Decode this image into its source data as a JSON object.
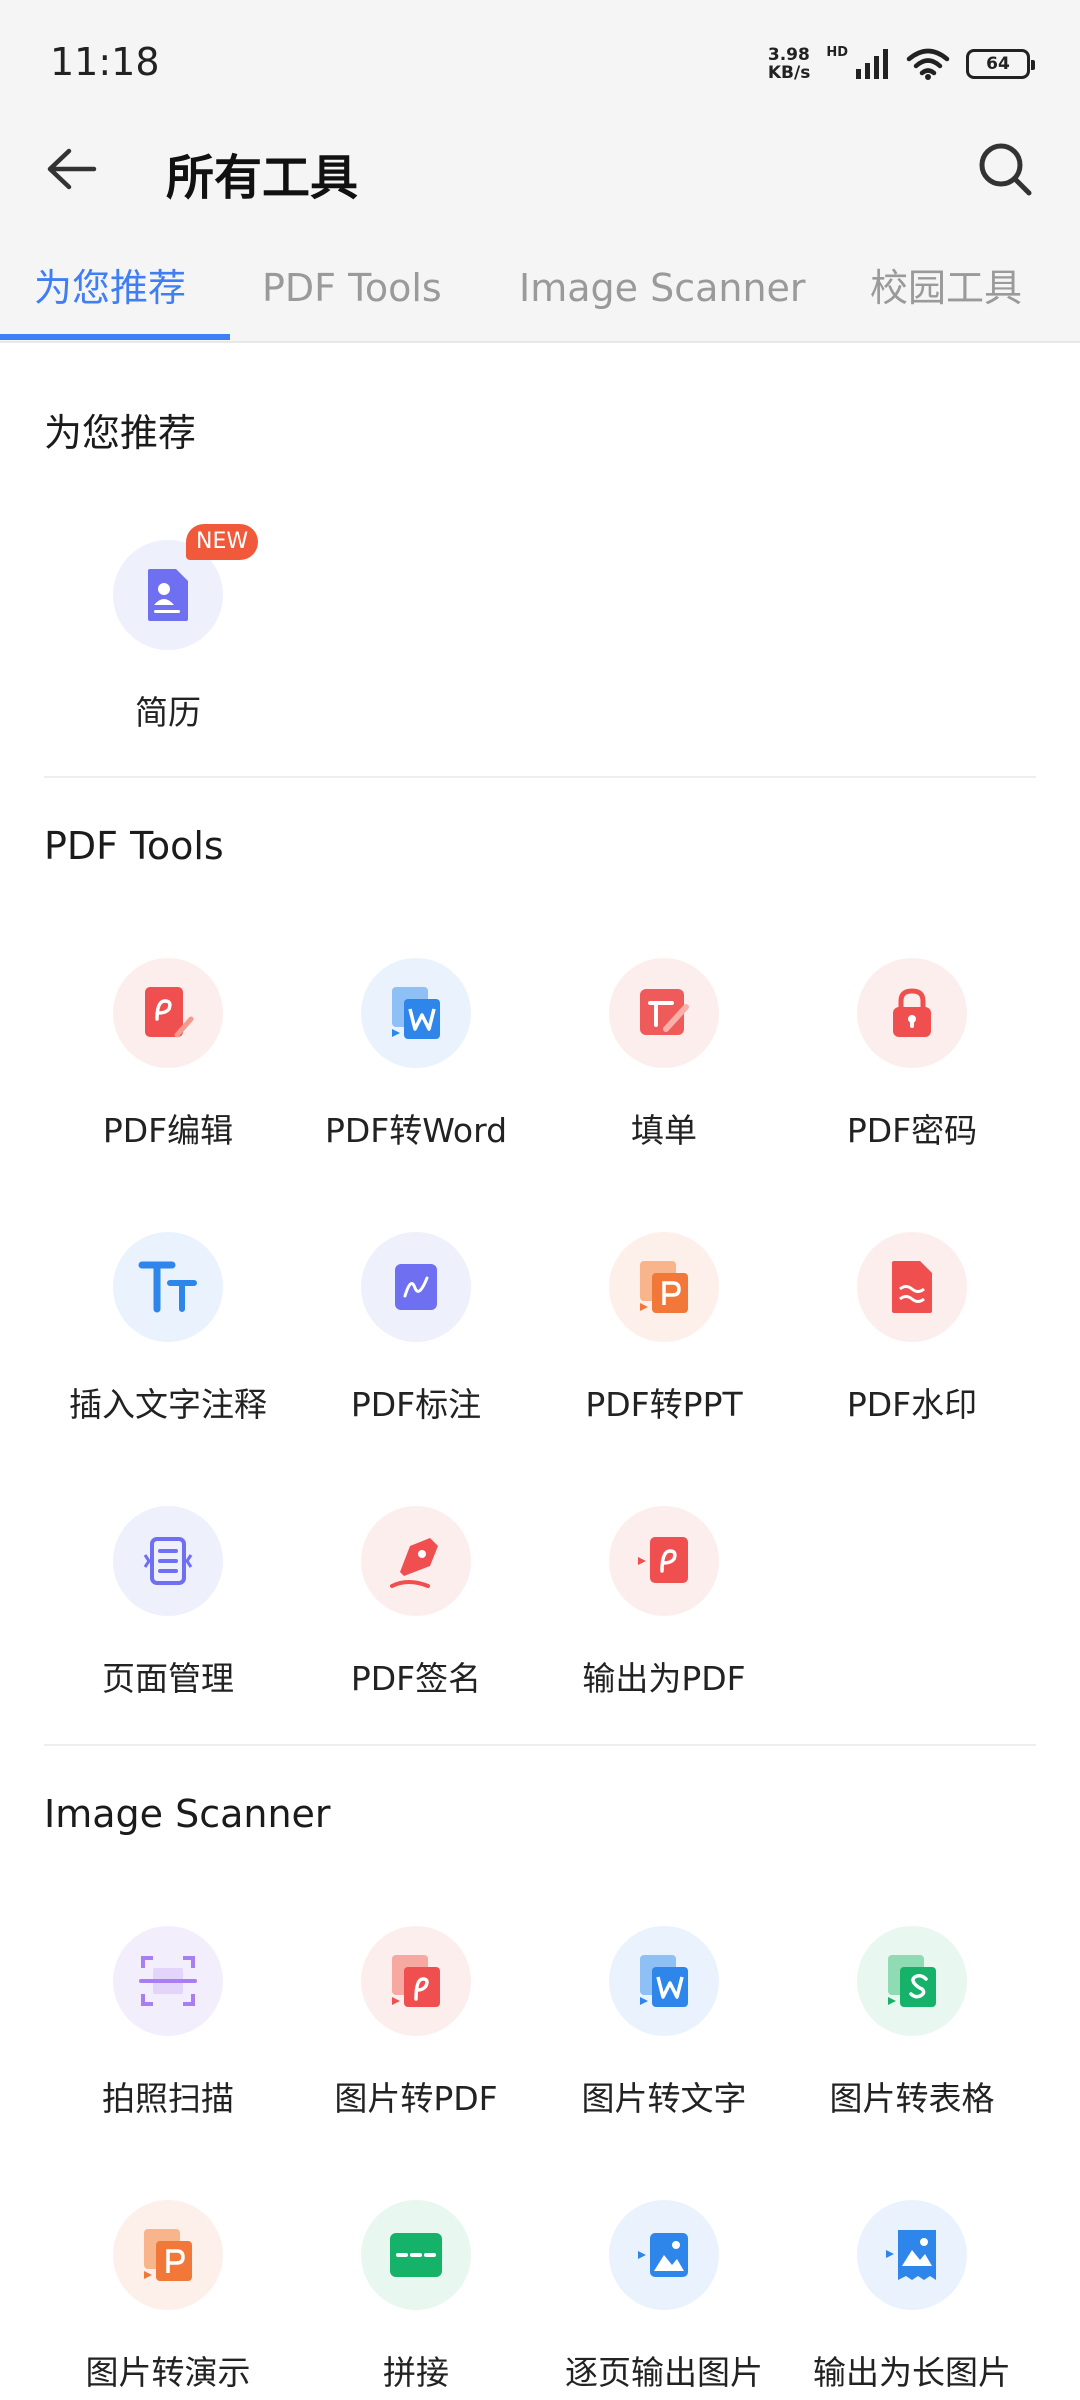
{
  "status_bar": {
    "time": "11:18",
    "net_speed_value": "3.98",
    "net_speed_unit": "KB/s",
    "hd_label": "HD",
    "battery": "64"
  },
  "header": {
    "title": "所有工具",
    "back_icon": "arrow-left-icon",
    "search_icon": "search-icon"
  },
  "tabs": [
    {
      "label": "为您推荐",
      "active": true
    },
    {
      "label": "PDF Tools",
      "active": false
    },
    {
      "label": "Image Scanner",
      "active": false
    },
    {
      "label": "校园工具",
      "active": false
    }
  ],
  "accent_color": "#3f7ef5",
  "sections": {
    "recommended": {
      "title": "为您推荐",
      "tools": [
        {
          "label": "简历",
          "icon": "resume-icon",
          "badge": "NEW"
        }
      ]
    },
    "pdf_tools": {
      "title": "PDF Tools",
      "tools": [
        {
          "label": "PDF编辑",
          "icon": "pdf-edit-icon"
        },
        {
          "label": "PDF转Word",
          "icon": "pdf-to-word-icon"
        },
        {
          "label": "填单",
          "icon": "fill-form-icon"
        },
        {
          "label": "PDF密码",
          "icon": "lock-icon"
        },
        {
          "label": "插入文字注释",
          "icon": "text-annotation-icon"
        },
        {
          "label": "PDF标注",
          "icon": "pdf-markup-icon"
        },
        {
          "label": "PDF转PPT",
          "icon": "pdf-to-ppt-icon"
        },
        {
          "label": "PDF水印",
          "icon": "watermark-icon"
        },
        {
          "label": "页面管理",
          "icon": "page-manage-icon"
        },
        {
          "label": "PDF签名",
          "icon": "signature-pen-icon"
        },
        {
          "label": "输出为PDF",
          "icon": "export-pdf-icon"
        }
      ]
    },
    "image_scanner": {
      "title": "Image Scanner",
      "tools": [
        {
          "label": "拍照扫描",
          "icon": "scan-icon"
        },
        {
          "label": "图片转PDF",
          "icon": "image-to-pdf-icon"
        },
        {
          "label": "图片转文字",
          "icon": "image-to-word-icon"
        },
        {
          "label": "图片转表格",
          "icon": "image-to-sheet-icon"
        },
        {
          "label": "图片转演示",
          "icon": "image-to-ppt-icon"
        },
        {
          "label": "拼接",
          "icon": "stitch-icon"
        },
        {
          "label": "逐页输出图片",
          "icon": "export-images-icon"
        },
        {
          "label": "输出为长图片",
          "icon": "export-long-image-icon"
        }
      ]
    }
  }
}
